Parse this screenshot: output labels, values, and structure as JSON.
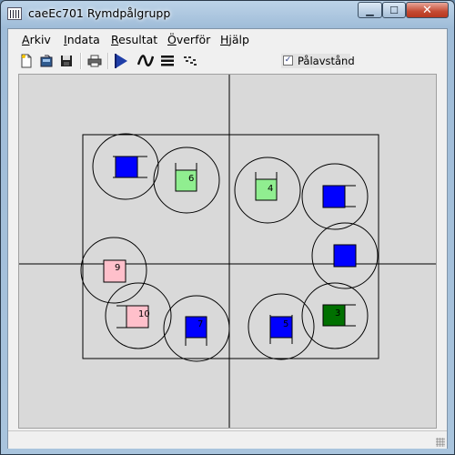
{
  "window": {
    "title": "caeEc701 Rymdpålgrupp"
  },
  "menu": [
    {
      "first": "A",
      "rest": "rkiv"
    },
    {
      "first": "I",
      "rest": "ndata"
    },
    {
      "first": "R",
      "rest": "esultat"
    },
    {
      "first": "Ö",
      "rest": "verför"
    },
    {
      "first": "H",
      "rest": "jälp"
    }
  ],
  "toolbar": {
    "icons": [
      "new-file-icon",
      "open-file-icon",
      "save-icon",
      "print-icon",
      "run-icon",
      "curve-icon",
      "lines-icon",
      "dots-icon"
    ],
    "checkbox_label": "Pålavstånd",
    "checkbox_checked": true
  },
  "colors": {
    "pile_blue": "#0000ff",
    "pile_green_light": "#90ee90",
    "pile_green_dark": "#007000",
    "pile_pink": "#ffc0cb",
    "canvas_bg": "#d9d9d9"
  },
  "piles": [
    {
      "label": "",
      "color": "blue"
    },
    {
      "label": "6",
      "color": "lightgreen"
    },
    {
      "label": "4",
      "color": "lightgreen"
    },
    {
      "label": "",
      "color": "blue"
    },
    {
      "label": "",
      "color": "blue"
    },
    {
      "label": "9",
      "color": "pink"
    },
    {
      "label": "10",
      "color": "pink"
    },
    {
      "label": "7",
      "color": "blue"
    },
    {
      "label": "5",
      "color": "blue"
    },
    {
      "label": "3",
      "color": "darkgreen"
    }
  ]
}
